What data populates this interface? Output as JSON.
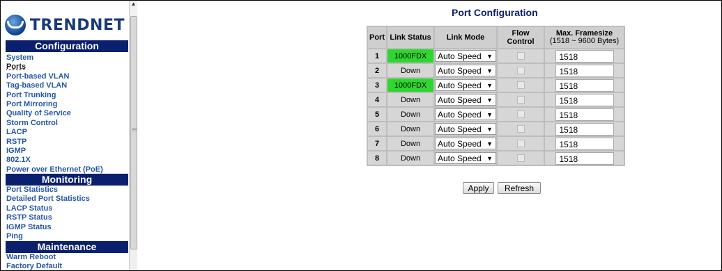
{
  "logo": {
    "brand": "TRENDNET"
  },
  "sidebar": {
    "configuration": {
      "header": "Configuration",
      "items": [
        "System",
        "Ports",
        "Port-based VLAN",
        "Tag-based VLAN",
        "Port Trunking",
        "Port Mirroring",
        "Quality of Service",
        "Storm Control",
        "LACP",
        "RSTP",
        "IGMP",
        "802.1X",
        "Power over Ethernet (PoE)"
      ]
    },
    "monitoring": {
      "header": "Monitoring",
      "items": [
        "Port Statistics",
        "Detailed Port Statistics",
        "LACP Status",
        "RSTP Status",
        "IGMP Status",
        "Ping"
      ]
    },
    "maintenance": {
      "header": "Maintenance",
      "items": [
        "Warm Reboot",
        "Factory Default"
      ]
    }
  },
  "main": {
    "title": "Port Configuration",
    "columns": {
      "port": "Port",
      "link_status": "Link Status",
      "link_mode": "Link Mode",
      "flow_control": "Flow Control",
      "max_framesize": "Max. Framesize",
      "max_framesize_range": "(1518 ~ 9600 Bytes)"
    },
    "rows": [
      {
        "port": "1",
        "status": "1000FDX",
        "up": true,
        "mode": "Auto Speed",
        "framesize": "1518"
      },
      {
        "port": "2",
        "status": "Down",
        "up": false,
        "mode": "Auto Speed",
        "framesize": "1518"
      },
      {
        "port": "3",
        "status": "1000FDX",
        "up": true,
        "mode": "Auto Speed",
        "framesize": "1518"
      },
      {
        "port": "4",
        "status": "Down",
        "up": false,
        "mode": "Auto Speed",
        "framesize": "1518"
      },
      {
        "port": "5",
        "status": "Down",
        "up": false,
        "mode": "Auto Speed",
        "framesize": "1518"
      },
      {
        "port": "6",
        "status": "Down",
        "up": false,
        "mode": "Auto Speed",
        "framesize": "1518"
      },
      {
        "port": "7",
        "status": "Down",
        "up": false,
        "mode": "Auto Speed",
        "framesize": "1518"
      },
      {
        "port": "8",
        "status": "Down",
        "up": false,
        "mode": "Auto Speed",
        "framesize": "1518"
      }
    ],
    "apply_label": "Apply",
    "refresh_label": "Refresh"
  },
  "colors": {
    "nav_header_bg": "#0a1f6e",
    "link_up": "#2fd62f",
    "nav_link": "#2456a8"
  }
}
